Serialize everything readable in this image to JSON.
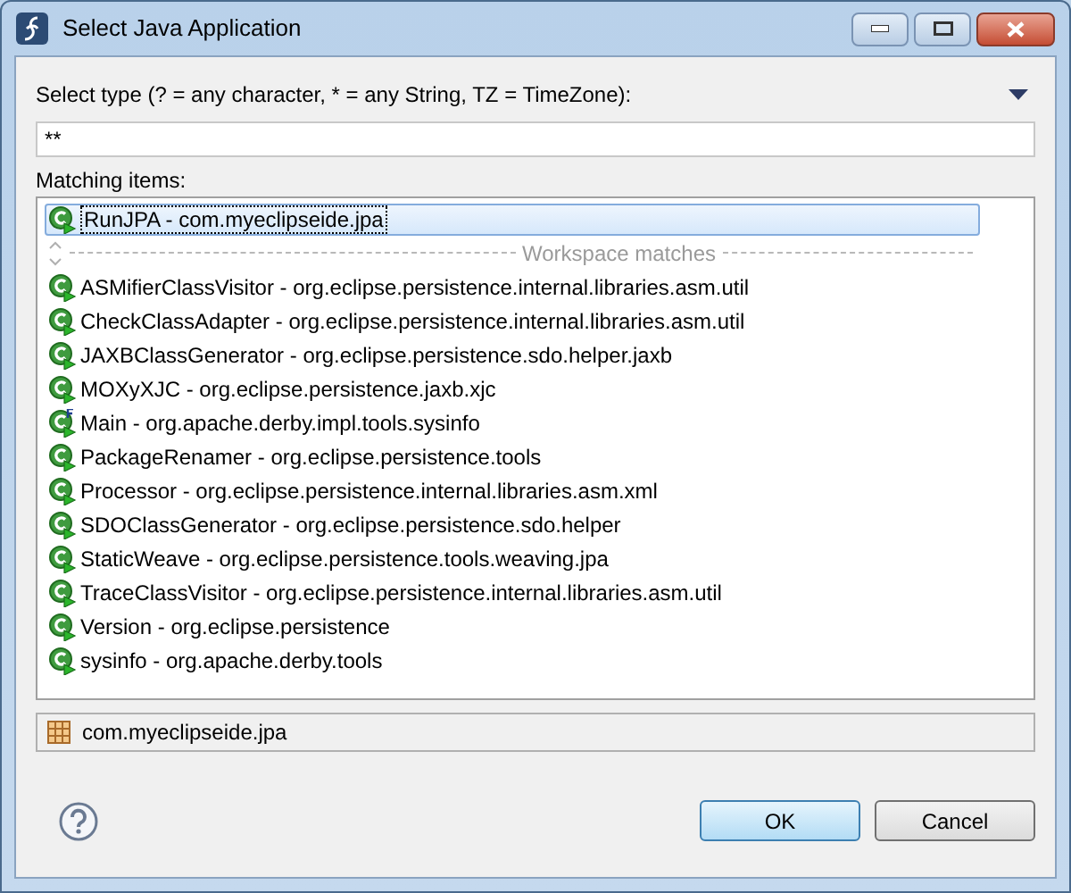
{
  "window": {
    "title": "Select Java Application"
  },
  "filter": {
    "label": "Select type (? = any character, * = any String, TZ = TimeZone):",
    "value": "**"
  },
  "list": {
    "label": "Matching items:",
    "items": [
      {
        "kind": "class",
        "text": "RunJPA - com.myeclipseide.jpa",
        "selected": true
      },
      {
        "kind": "separator",
        "text": "Workspace matches",
        "selected": false
      },
      {
        "kind": "class",
        "text": "ASMifierClassVisitor - org.eclipse.persistence.internal.libraries.asm.util",
        "selected": false
      },
      {
        "kind": "class",
        "text": "CheckClassAdapter - org.eclipse.persistence.internal.libraries.asm.util",
        "selected": false
      },
      {
        "kind": "class",
        "text": "JAXBClassGenerator - org.eclipse.persistence.sdo.helper.jaxb",
        "selected": false
      },
      {
        "kind": "class",
        "text": "MOXyXJC - org.eclipse.persistence.jaxb.xjc",
        "selected": false
      },
      {
        "kind": "main",
        "text": "Main - org.apache.derby.impl.tools.sysinfo",
        "selected": false
      },
      {
        "kind": "class",
        "text": "PackageRenamer - org.eclipse.persistence.tools",
        "selected": false
      },
      {
        "kind": "class",
        "text": "Processor - org.eclipse.persistence.internal.libraries.asm.xml",
        "selected": false
      },
      {
        "kind": "class",
        "text": "SDOClassGenerator - org.eclipse.persistence.sdo.helper",
        "selected": false
      },
      {
        "kind": "class",
        "text": "StaticWeave - org.eclipse.persistence.tools.weaving.jpa",
        "selected": false
      },
      {
        "kind": "class",
        "text": "TraceClassVisitor - org.eclipse.persistence.internal.libraries.asm.util",
        "selected": false
      },
      {
        "kind": "class",
        "text": "Version - org.eclipse.persistence",
        "selected": false
      },
      {
        "kind": "class",
        "text": "sysinfo - org.apache.derby.tools",
        "selected": false
      }
    ]
  },
  "details": {
    "text": "com.myeclipseide.jpa"
  },
  "buttons": [
    {
      "label": "OK",
      "default": true
    },
    {
      "label": "Cancel",
      "default": false
    }
  ]
}
